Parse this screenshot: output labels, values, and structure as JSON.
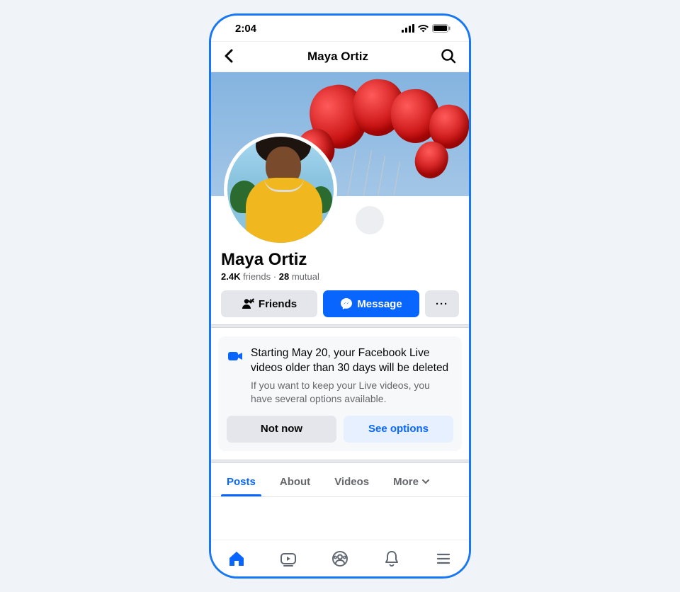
{
  "status": {
    "time": "2:04"
  },
  "header": {
    "title": "Maya Ortiz"
  },
  "profile": {
    "name": "Maya Ortiz",
    "friends_count": "2.4K",
    "friends_label": "friends",
    "sep": "·",
    "mutual_count": "28",
    "mutual_label": "mutual"
  },
  "actions": {
    "friends": "Friends",
    "message": "Message",
    "more": "···"
  },
  "notice": {
    "title": "Starting May 20, your Facebook Live videos older than 30 days will be deleted",
    "body": "If you want to keep your Live videos, you have several options available.",
    "not_now": "Not now",
    "see_options": "See options"
  },
  "tabs": {
    "posts": "Posts",
    "about": "About",
    "videos": "Videos",
    "more": "More"
  }
}
